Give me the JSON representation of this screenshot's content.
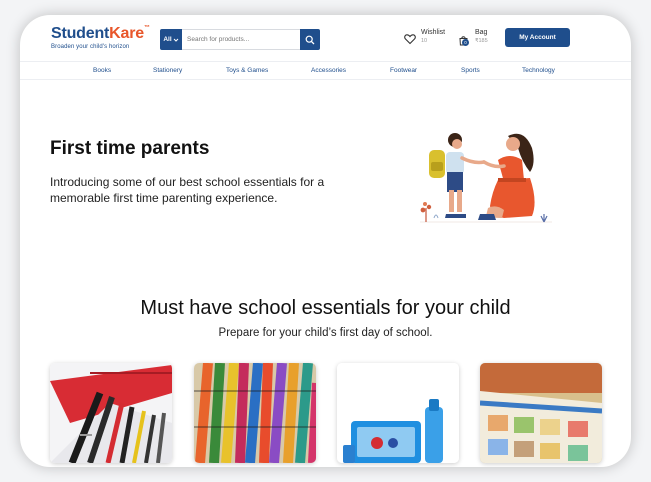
{
  "brand": {
    "name_part1": "Student",
    "name_part2": "Kare",
    "trademark": "™",
    "tagline": "Broaden your child's horizon"
  },
  "search": {
    "category": "All",
    "placeholder": "Search for products..."
  },
  "wishlist": {
    "label": "Wishlist",
    "count": "10"
  },
  "bag": {
    "label": "Bag",
    "total": "₹185",
    "count": "0"
  },
  "account_label": "My Account",
  "nav": [
    "Books",
    "Stationery",
    "Toys & Games",
    "Accessories",
    "Footwear",
    "Sports",
    "Technology"
  ],
  "hero": {
    "title": "First time parents",
    "text": "Introducing some of our best school essentials for a memorable first time parenting experience."
  },
  "essentials": {
    "title": "Must have school essentials for your child",
    "subtitle": "Prepare for your child’s first day of school."
  },
  "cards": [
    {
      "image": "pens-in-pencil-case"
    },
    {
      "image": "crayons"
    },
    {
      "image": "lunch-box-and-bottle"
    },
    {
      "image": "picture-books"
    }
  ],
  "colors": {
    "primary": "#1f4e8c",
    "accent": "#e8562a"
  }
}
